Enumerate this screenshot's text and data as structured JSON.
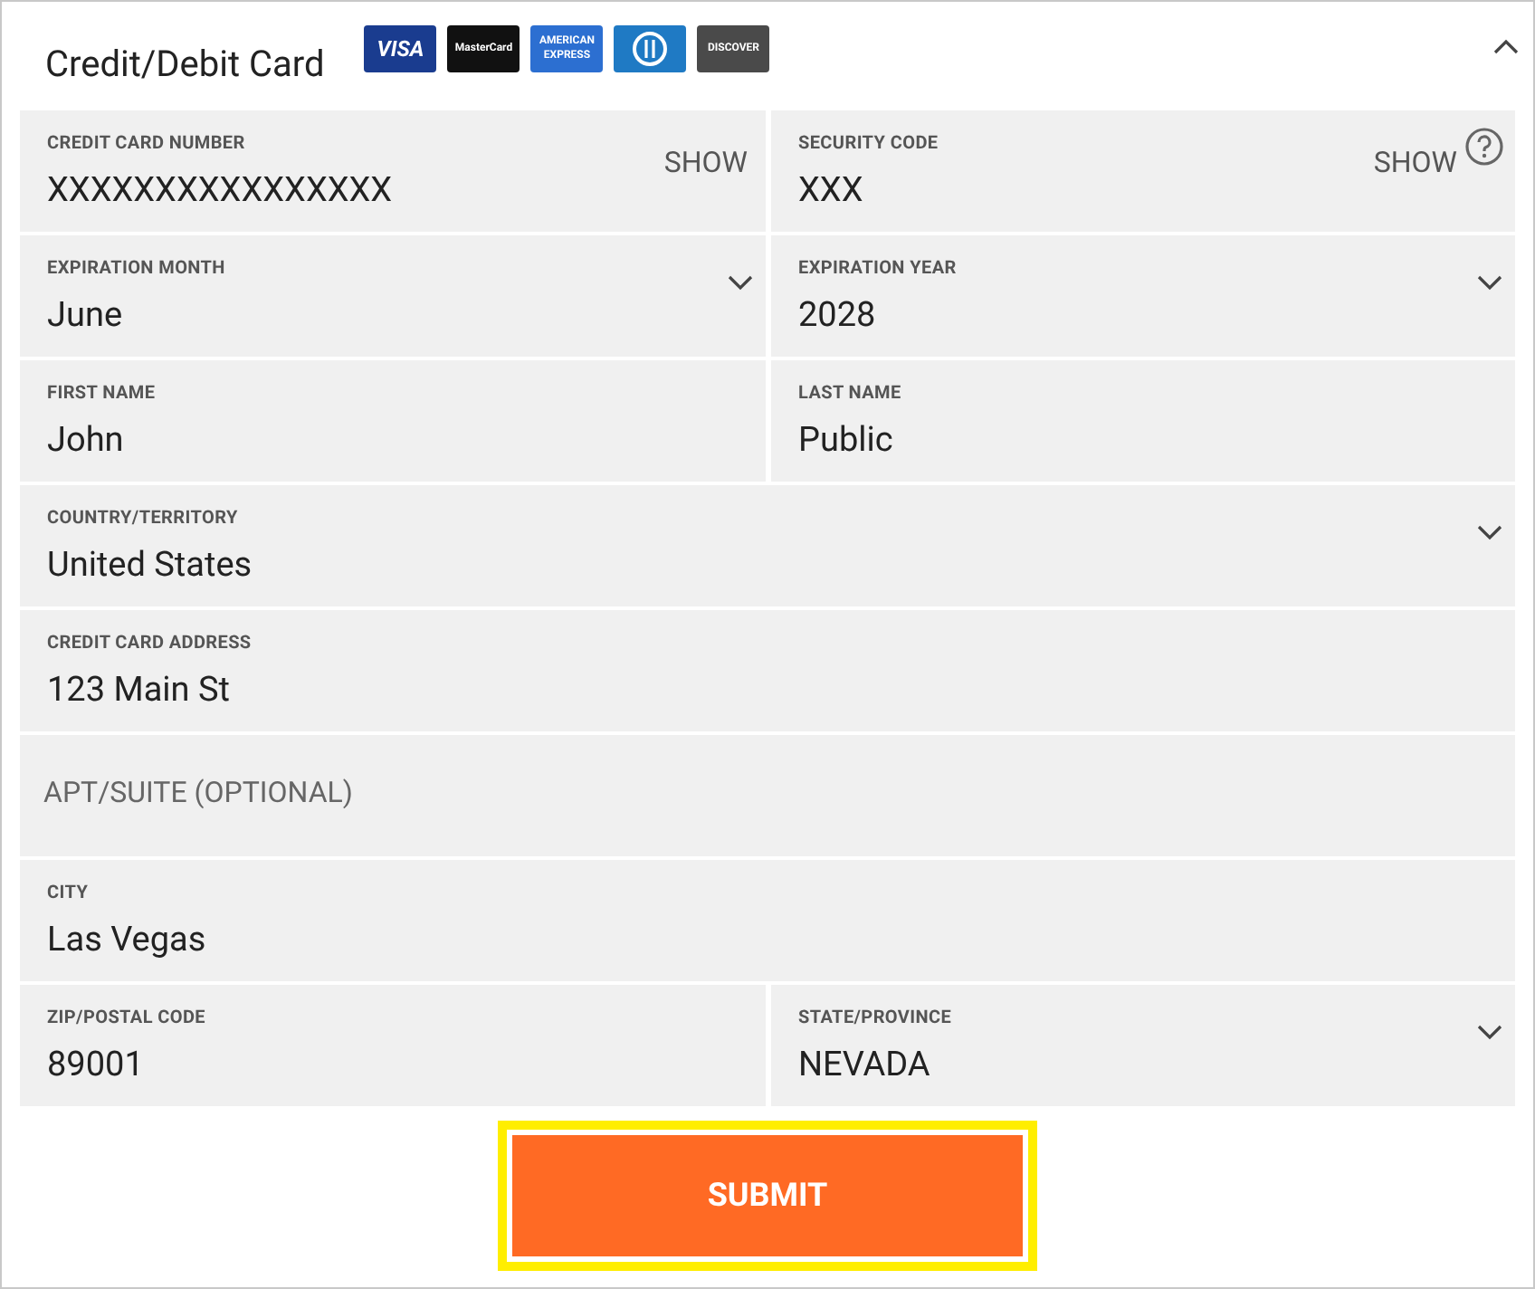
{
  "header": {
    "title": "Credit/Debit Card",
    "expanded": true,
    "cards": [
      {
        "label": "VISA",
        "color": "#1a3c8f"
      },
      {
        "label": "MasterCard",
        "color": "#111111"
      },
      {
        "label": "AMERICAN EXPRESS",
        "color": "#2c6fd1"
      },
      {
        "color": "#1f7ac4",
        "kind": "diners"
      },
      {
        "label": "DISCOVER",
        "color": "#4a4a4a"
      }
    ]
  },
  "rows": [
    [
      {
        "kind": "input",
        "label": "CREDIT CARD NUMBER",
        "value": "XXXXXXXXXXXXXXXX",
        "action": "SHOW"
      },
      {
        "kind": "input",
        "label": "SECURITY CODE",
        "value": "XXX",
        "action": "SHOW",
        "help": true
      }
    ],
    [
      {
        "kind": "select",
        "label": "EXPIRATION MONTH",
        "value": "June"
      },
      {
        "kind": "select",
        "label": "EXPIRATION YEAR",
        "value": "2028"
      }
    ],
    [
      {
        "kind": "input",
        "label": "FIRST NAME",
        "value": "John"
      },
      {
        "kind": "input",
        "label": "LAST NAME",
        "value": "Public"
      }
    ],
    [
      {
        "kind": "select",
        "label": "COUNTRY/TERRITORY",
        "value": "United States"
      }
    ],
    [
      {
        "kind": "input",
        "label": "CREDIT CARD ADDRESS",
        "value": "123 Main St"
      }
    ],
    [
      {
        "kind": "input",
        "placeholder": "APT/SUITE (OPTIONAL)"
      }
    ],
    [
      {
        "kind": "input",
        "label": "CITY",
        "value": "Las Vegas"
      }
    ],
    [
      {
        "kind": "input",
        "label": "ZIP/POSTAL CODE",
        "value": "89001"
      },
      {
        "kind": "select",
        "label": "STATE/PROVINCE",
        "value": "NEVADA"
      }
    ]
  ],
  "submit": {
    "label": "SUBMIT",
    "focused": true
  }
}
